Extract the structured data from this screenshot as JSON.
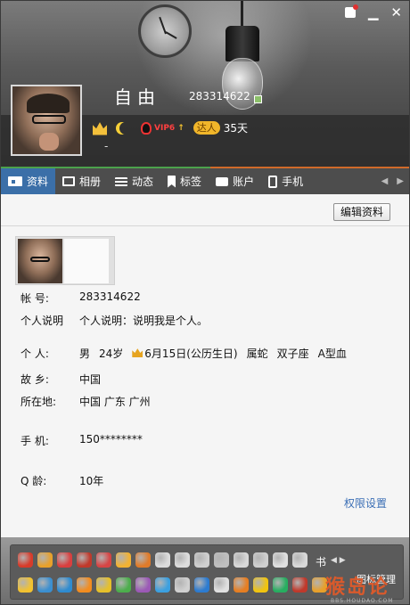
{
  "window": {
    "skin_icon": "skin-icon",
    "minimize": "▁",
    "close": "✕"
  },
  "profile": {
    "nickname": "自由",
    "qq_number": "283314622",
    "vip_label": "VIP6",
    "vip_arrow": "↑",
    "talent_label": "达人",
    "talent_days": "35天",
    "signature_dash": "-"
  },
  "tabs": [
    {
      "label": "资料",
      "icon": "id-card-icon"
    },
    {
      "label": "相册",
      "icon": "photo-icon"
    },
    {
      "label": "动态",
      "icon": "list-icon"
    },
    {
      "label": "标签",
      "icon": "bookmark-icon"
    },
    {
      "label": "账户",
      "icon": "briefcase-icon"
    },
    {
      "label": "手机",
      "icon": "phone-icon"
    }
  ],
  "tab_arrows": {
    "left": "◀",
    "right": "▶"
  },
  "edit_button": "编辑资料",
  "info": {
    "account_label": "帐 号:",
    "account_value": "283314622",
    "desc_label": "个人说明",
    "desc_value": "个人说明：说明我是个人。",
    "personal_label": "个 人:",
    "gender": "男",
    "age": "24岁",
    "birthday": "6月15日(公历生日)",
    "zodiac": "属蛇",
    "constellation": "双子座",
    "blood": "A型血",
    "hometown_label": "故 乡:",
    "hometown_value": "中国",
    "location_label": "所在地:",
    "location_value": "中国 广东 广州",
    "phone_label": "手 机:",
    "phone_value": "150********",
    "qage_label": "Q 龄:",
    "qage_value": "10年"
  },
  "permission_link": "权限设置",
  "iconbar": {
    "char_icon": "书",
    "arrows": "◀ ▶",
    "manage_label": "图标管理",
    "row1_colors": [
      "#d83b2a",
      "#e8a12b",
      "#d93f3f",
      "#c0392b",
      "#d64545",
      "#f2b233",
      "#e07b2a",
      "#dcdcdc",
      "#dcdcdc",
      "#cfcfcf",
      "#bfbfbf",
      "#d8d8d8",
      "#cfcfcf",
      "#e0e0e0",
      "#d9d9d9",
      "#e5e5e5"
    ],
    "row2_colors": [
      "#f2c230",
      "#3b8fd0",
      "#2e8bd0",
      "#f28c1f",
      "#e6c02a",
      "#4cae4c",
      "#9b59b6",
      "#3ba0e0",
      "#d0d0d0",
      "#2c7bd0",
      "#e0e0e0",
      "#e67e22",
      "#f1c40f",
      "#27ae60",
      "#c0392b",
      "#e8a02a",
      "#d35400",
      "#16a085"
    ]
  },
  "watermark": {
    "text": "猴岛论坛",
    "url": "BBS.HOUDAO.COM"
  }
}
